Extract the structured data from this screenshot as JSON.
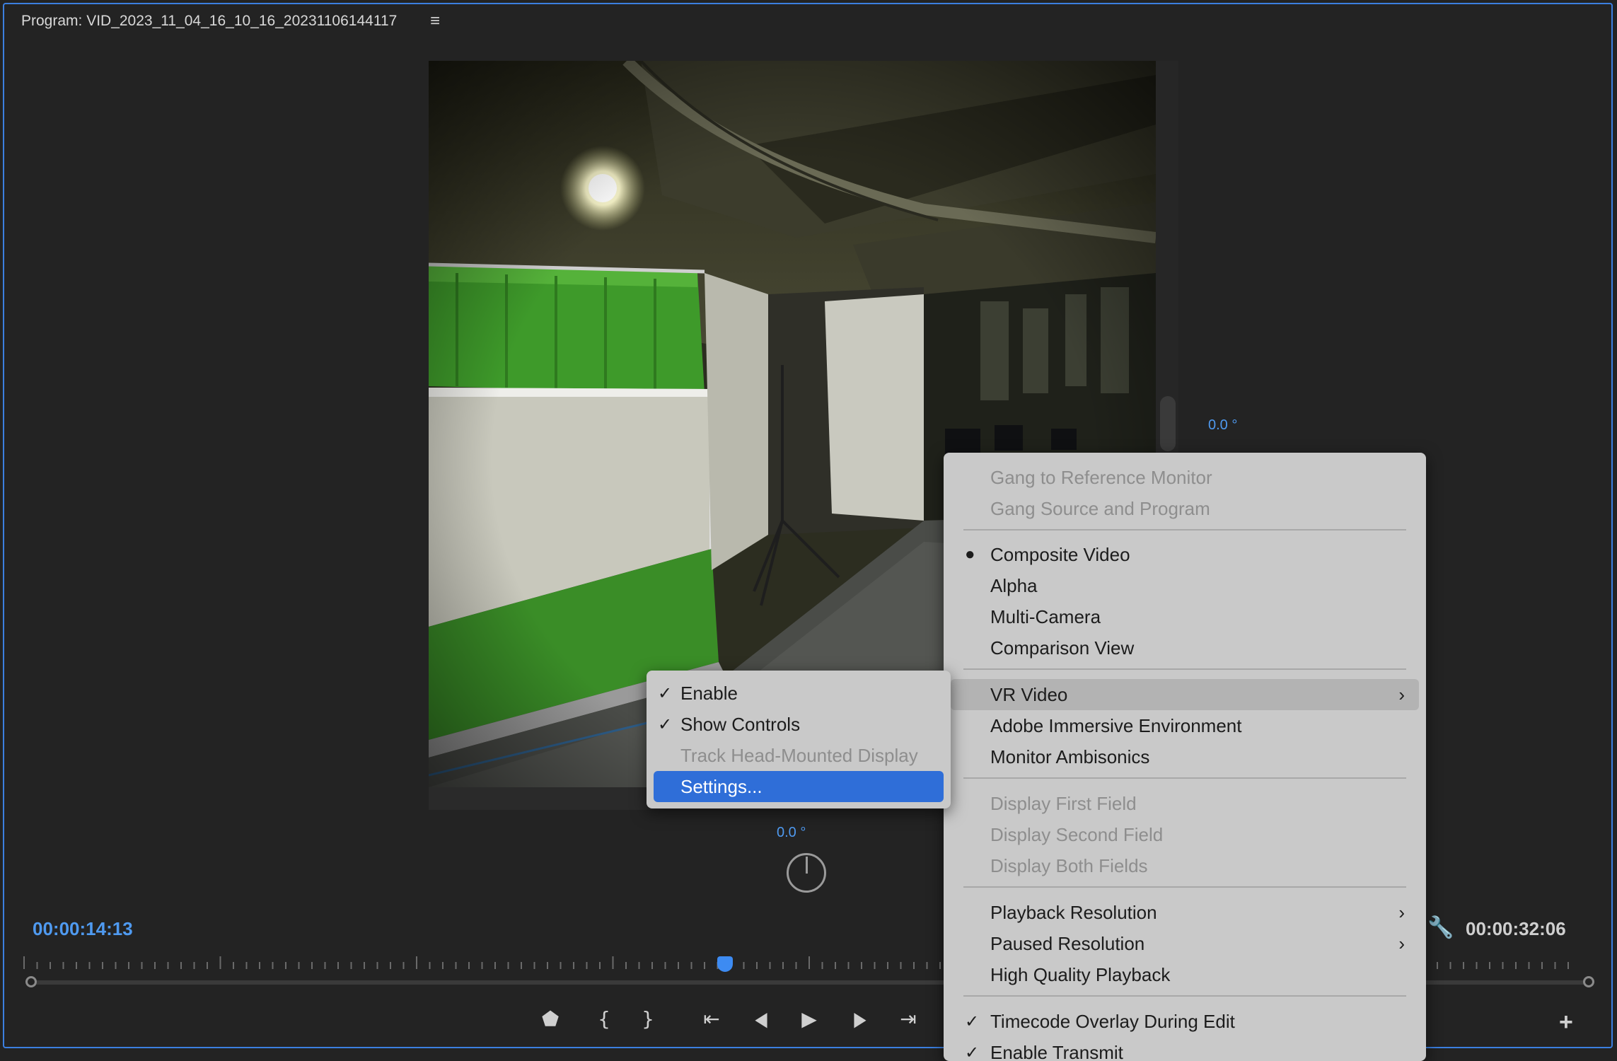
{
  "panel": {
    "title": "Program: VID_2023_11_04_16_10_16_20231106144117",
    "menu_glyph": "≡"
  },
  "vr": {
    "vertical_angle": "0.0 °",
    "horizontal_angle": "0.0 °"
  },
  "timecodes": {
    "current": "00:00:14:13",
    "duration": "00:00:32:06"
  },
  "transport": {
    "marker_icon": "⬟",
    "mark_in_icon": "{",
    "mark_out_icon": "}",
    "go_to_in_icon": "⇤",
    "step_back_icon": "◀",
    "play_icon": "▶",
    "step_forward_icon": "▶",
    "go_to_out_icon": "⇥",
    "add_icon": "+"
  },
  "main_menu": {
    "items": [
      {
        "label": "Gang to Reference Monitor",
        "disabled": true
      },
      {
        "label": "Gang Source and Program",
        "disabled": true
      },
      {
        "label": "Composite Video",
        "mark": "●"
      },
      {
        "label": "Alpha"
      },
      {
        "label": "Multi-Camera"
      },
      {
        "label": "Comparison View"
      },
      {
        "label": "VR Video",
        "arrow": "›"
      },
      {
        "label": "Adobe Immersive Environment"
      },
      {
        "label": "Monitor Ambisonics"
      },
      {
        "label": "Display First Field",
        "disabled": true
      },
      {
        "label": "Display Second Field",
        "disabled": true
      },
      {
        "label": "Display Both Fields",
        "disabled": true
      },
      {
        "label": "Playback Resolution",
        "arrow": "›"
      },
      {
        "label": "Paused Resolution",
        "arrow": "›"
      },
      {
        "label": "High Quality Playback"
      },
      {
        "label": "Timecode Overlay During Edit",
        "mark": "✓"
      },
      {
        "label": "Enable Transmit",
        "mark": "✓"
      }
    ]
  },
  "vr_submenu": {
    "items": [
      {
        "label": "Enable",
        "mark": "✓"
      },
      {
        "label": "Show Controls",
        "mark": "✓"
      },
      {
        "label": "Track Head-Mounted Display",
        "disabled": true
      },
      {
        "label": "Settings...",
        "selected": true
      }
    ]
  },
  "colors": {
    "accent": "#4f9af0",
    "selection": "#2f6ed8",
    "panel_border": "#3b7fe0"
  }
}
